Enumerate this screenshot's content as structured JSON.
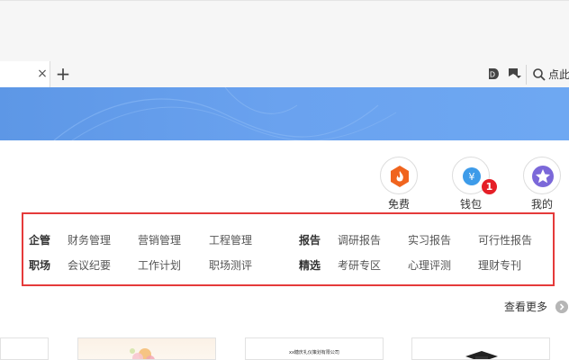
{
  "browser": {
    "tab_close": "×",
    "new_tab": "+",
    "search_text": "点此"
  },
  "actions": [
    {
      "label": "免费",
      "color": "#f0641e"
    },
    {
      "label": "钱包",
      "color": "#3d9be9"
    },
    {
      "label": "我的",
      "color": "#7b68d9"
    }
  ],
  "wallet_badge": "1",
  "categories": {
    "left": [
      {
        "head": "企管",
        "links": [
          "财务管理",
          "营销管理",
          "工程管理"
        ]
      },
      {
        "head": "职场",
        "links": [
          "会议纪要",
          "工作计划",
          "职场测评"
        ]
      }
    ],
    "right": [
      {
        "head": "报告",
        "links": [
          "调研报告",
          "实习报告",
          "可行性报告"
        ]
      },
      {
        "head": "精选",
        "links": [
          "考研专区",
          "心理评测",
          "理财专刊"
        ]
      }
    ]
  },
  "more_label": "查看更多",
  "thumb_doc_title": "xx糖庆礼仪策划有限公司",
  "colors": {
    "banner": "#6aa2ef",
    "highlight": "#e53a3a",
    "badge": "#e51f27"
  }
}
